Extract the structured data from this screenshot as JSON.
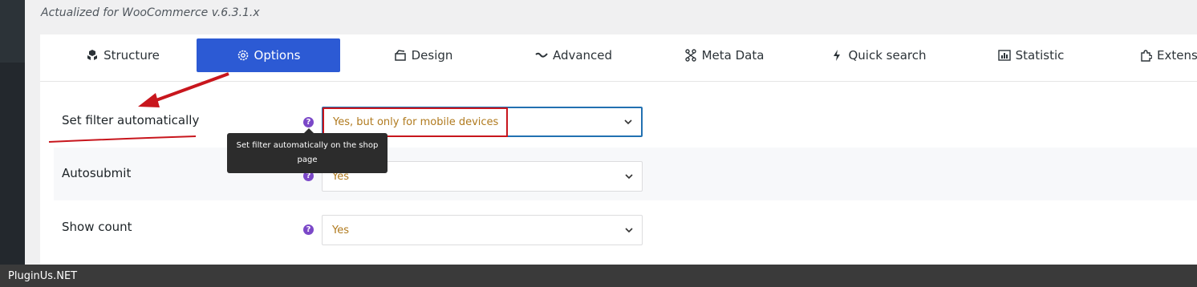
{
  "header": {
    "subtitle": "Actualized for WooCommerce v.6.3.1.x"
  },
  "tabs": [
    {
      "label": "Structure",
      "icon": "cubes-icon"
    },
    {
      "label": "Options",
      "icon": "gear-icon",
      "active": true
    },
    {
      "label": "Design",
      "icon": "design-icon"
    },
    {
      "label": "Advanced",
      "icon": "wave-icon"
    },
    {
      "label": "Meta Data",
      "icon": "nodes-icon"
    },
    {
      "label": "Quick search",
      "icon": "bolt-icon"
    },
    {
      "label": "Statistic",
      "icon": "bar-chart-icon"
    },
    {
      "label": "Extens",
      "icon": "puzzle-icon"
    }
  ],
  "settings": [
    {
      "label": "Set filter automatically",
      "value": "Yes, but only for mobile devices",
      "help_symbol": "?"
    },
    {
      "label": "Autosubmit",
      "value": "Yes",
      "help_symbol": "?"
    },
    {
      "label": "Show count",
      "value": "Yes",
      "help_symbol": "?"
    }
  ],
  "tooltip": {
    "line1": "Set filter automatically on the shop",
    "line2": "page"
  },
  "footer": {
    "brand": "PluginUs.NET"
  },
  "colors": {
    "accent": "#2c5ad4",
    "select_value": "#b07a1e",
    "help_icon": "#7b48c8",
    "annotation": "#c8161d"
  }
}
